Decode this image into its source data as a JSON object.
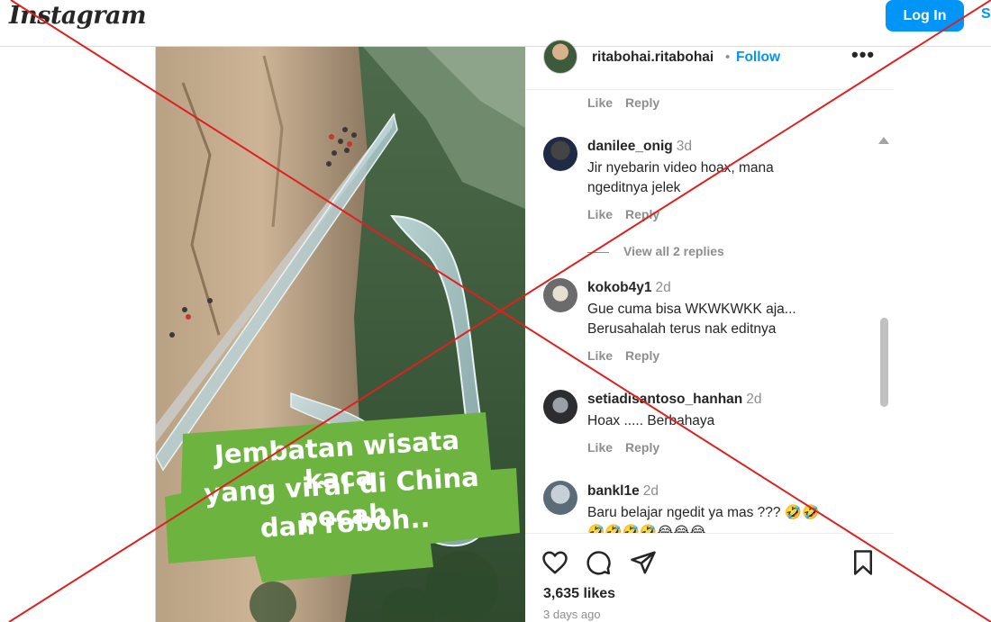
{
  "brand": {
    "logo_text": "Instagram"
  },
  "topbar": {
    "login_label": "Log In",
    "signup_label": "S"
  },
  "post": {
    "caption_overlay": {
      "line1": "Jembatan wisata kaca",
      "line2": "yang viral di China pecah",
      "line3": "dan roboh..",
      "bg_color": "#6db33f"
    },
    "author": {
      "username": "ritabohai.ritabohai",
      "separator": "•",
      "follow_label": "Follow",
      "more_label": "•••"
    },
    "first_comment_meta": {
      "like": "Like",
      "reply": "Reply"
    },
    "comments": [
      {
        "username": "danilee_onig",
        "time": "3d",
        "lines": [
          "Jir nyebarin video hoax, mana",
          "ngeditnya jelek"
        ],
        "like": "Like",
        "reply": "Reply",
        "view_replies": "View all 2 replies"
      },
      {
        "username": "kokob4y1",
        "time": "2d",
        "lines": [
          "Gue cuma bisa WKWKWKK aja...",
          "Berusahalah terus nak editnya"
        ],
        "like": "Like",
        "reply": "Reply"
      },
      {
        "username": "setiadisantoso_hanhan",
        "time": "2d",
        "lines": [
          "Hoax ..... Berbahaya"
        ],
        "like": "Like",
        "reply": "Reply"
      },
      {
        "username": "bankl1e",
        "time": "2d",
        "lines": [
          "Baru belajar ngedit ya mas ??? 🤣🤣",
          "🤣🤣🤣🤣😂😂😂"
        ]
      }
    ],
    "likes": "3,635 likes",
    "posted": "3 days ago"
  },
  "icons": [
    "heart-icon",
    "comment-icon",
    "share-icon",
    "bookmark-icon",
    "more-icon"
  ],
  "colors": {
    "accent": "#0095f6",
    "cross": "#e0201f"
  }
}
